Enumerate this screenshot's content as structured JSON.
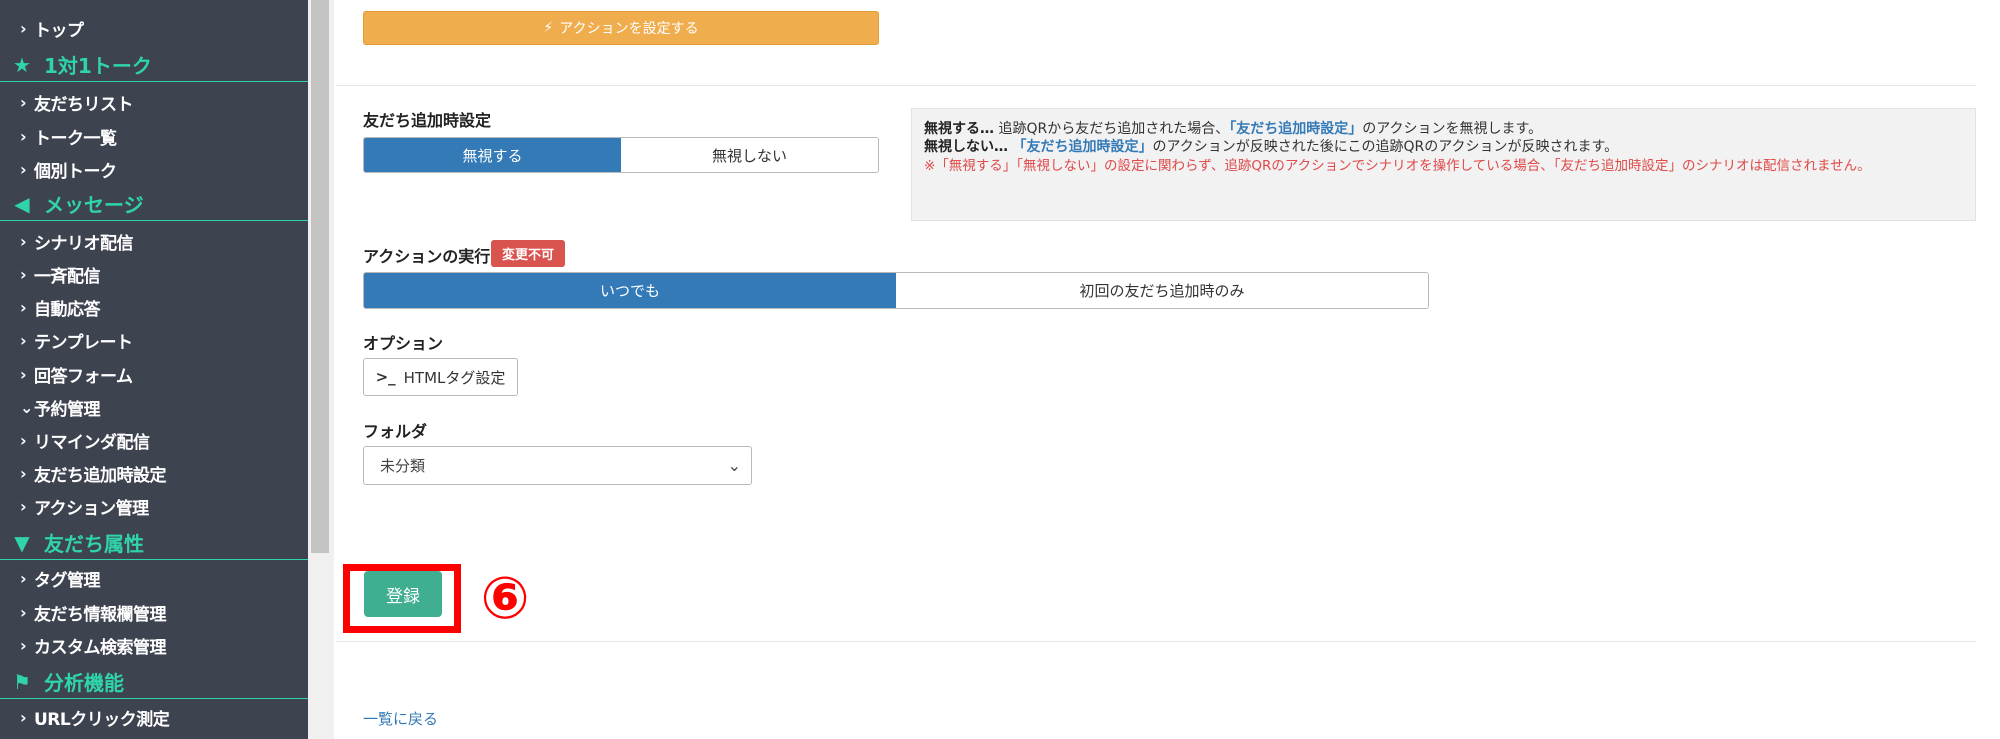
{
  "sidebar": {
    "items": [
      {
        "type": "item",
        "label": "トップ",
        "chevron": "right"
      },
      {
        "type": "section",
        "label": "1対1トーク",
        "icon": "star-icon"
      },
      {
        "type": "item",
        "label": "友だちリスト",
        "chevron": "right"
      },
      {
        "type": "item",
        "label": "トーク一覧",
        "chevron": "right"
      },
      {
        "type": "item",
        "label": "個別トーク",
        "chevron": "right"
      },
      {
        "type": "section",
        "label": "メッセージ",
        "icon": "megaphone-icon"
      },
      {
        "type": "item",
        "label": "シナリオ配信",
        "chevron": "right"
      },
      {
        "type": "item",
        "label": "一斉配信",
        "chevron": "right"
      },
      {
        "type": "item",
        "label": "自動応答",
        "chevron": "right"
      },
      {
        "type": "item",
        "label": "テンプレート",
        "chevron": "right"
      },
      {
        "type": "item",
        "label": "回答フォーム",
        "chevron": "right"
      },
      {
        "type": "item",
        "label": "予約管理",
        "chevron": "down"
      },
      {
        "type": "item",
        "label": "リマインダ配信",
        "chevron": "right"
      },
      {
        "type": "item",
        "label": "友だち追加時設定",
        "chevron": "right"
      },
      {
        "type": "item",
        "label": "アクション管理",
        "chevron": "right"
      },
      {
        "type": "section",
        "label": "友だち属性",
        "icon": "filter-icon"
      },
      {
        "type": "item",
        "label": "タグ管理",
        "chevron": "right"
      },
      {
        "type": "item",
        "label": "友だち情報欄管理",
        "chevron": "right"
      },
      {
        "type": "item",
        "label": "カスタム検索管理",
        "chevron": "right"
      },
      {
        "type": "section",
        "label": "分析機能",
        "icon": "flag-icon"
      },
      {
        "type": "item",
        "label": "URLクリック測定",
        "chevron": "right"
      }
    ]
  },
  "main": {
    "action_button": "アクションを設定する",
    "friend_add": {
      "label": "友だち追加時設定",
      "options": [
        "無視する",
        "無視しない"
      ],
      "selected": "無視する"
    },
    "info": {
      "line1_term": "無視する…",
      "line1_pre": " 追跡QRから友だち追加された場合、",
      "line1_hl": "「友だち追加時設定」",
      "line1_post": "のアクションを無視します。",
      "line2_term": "無視しない…",
      "line2_hl": "「友だち追加時設定」",
      "line2_post": "のアクションが反映された後にこの追跡QRのアクションが反映されます。",
      "note": "※「無視する」「無視しない」の設定に関わらず、追跡QRのアクションでシナリオを操作している場合、「友だち追加時設定」のシナリオは配信されません。"
    },
    "execution": {
      "label": "アクションの実行",
      "badge": "変更不可",
      "options": [
        "いつでも",
        "初回の友だち追加時のみ"
      ],
      "selected": "いつでも"
    },
    "option": {
      "label": "オプション",
      "html_button": "HTMLタグ設定"
    },
    "folder": {
      "label": "フォルダ",
      "value": "未分類"
    },
    "register_button": "登録",
    "step_marker": "⑥",
    "back_link": "一覧に戻る"
  },
  "colors": {
    "sidebar_bg": "#3e4350",
    "section_accent": "#2fd4a8",
    "primary": "#337ab7",
    "warning": "#f0ad4e",
    "danger": "#d9534f",
    "success": "#3fae91",
    "highlight_frame": "#ff0000"
  }
}
